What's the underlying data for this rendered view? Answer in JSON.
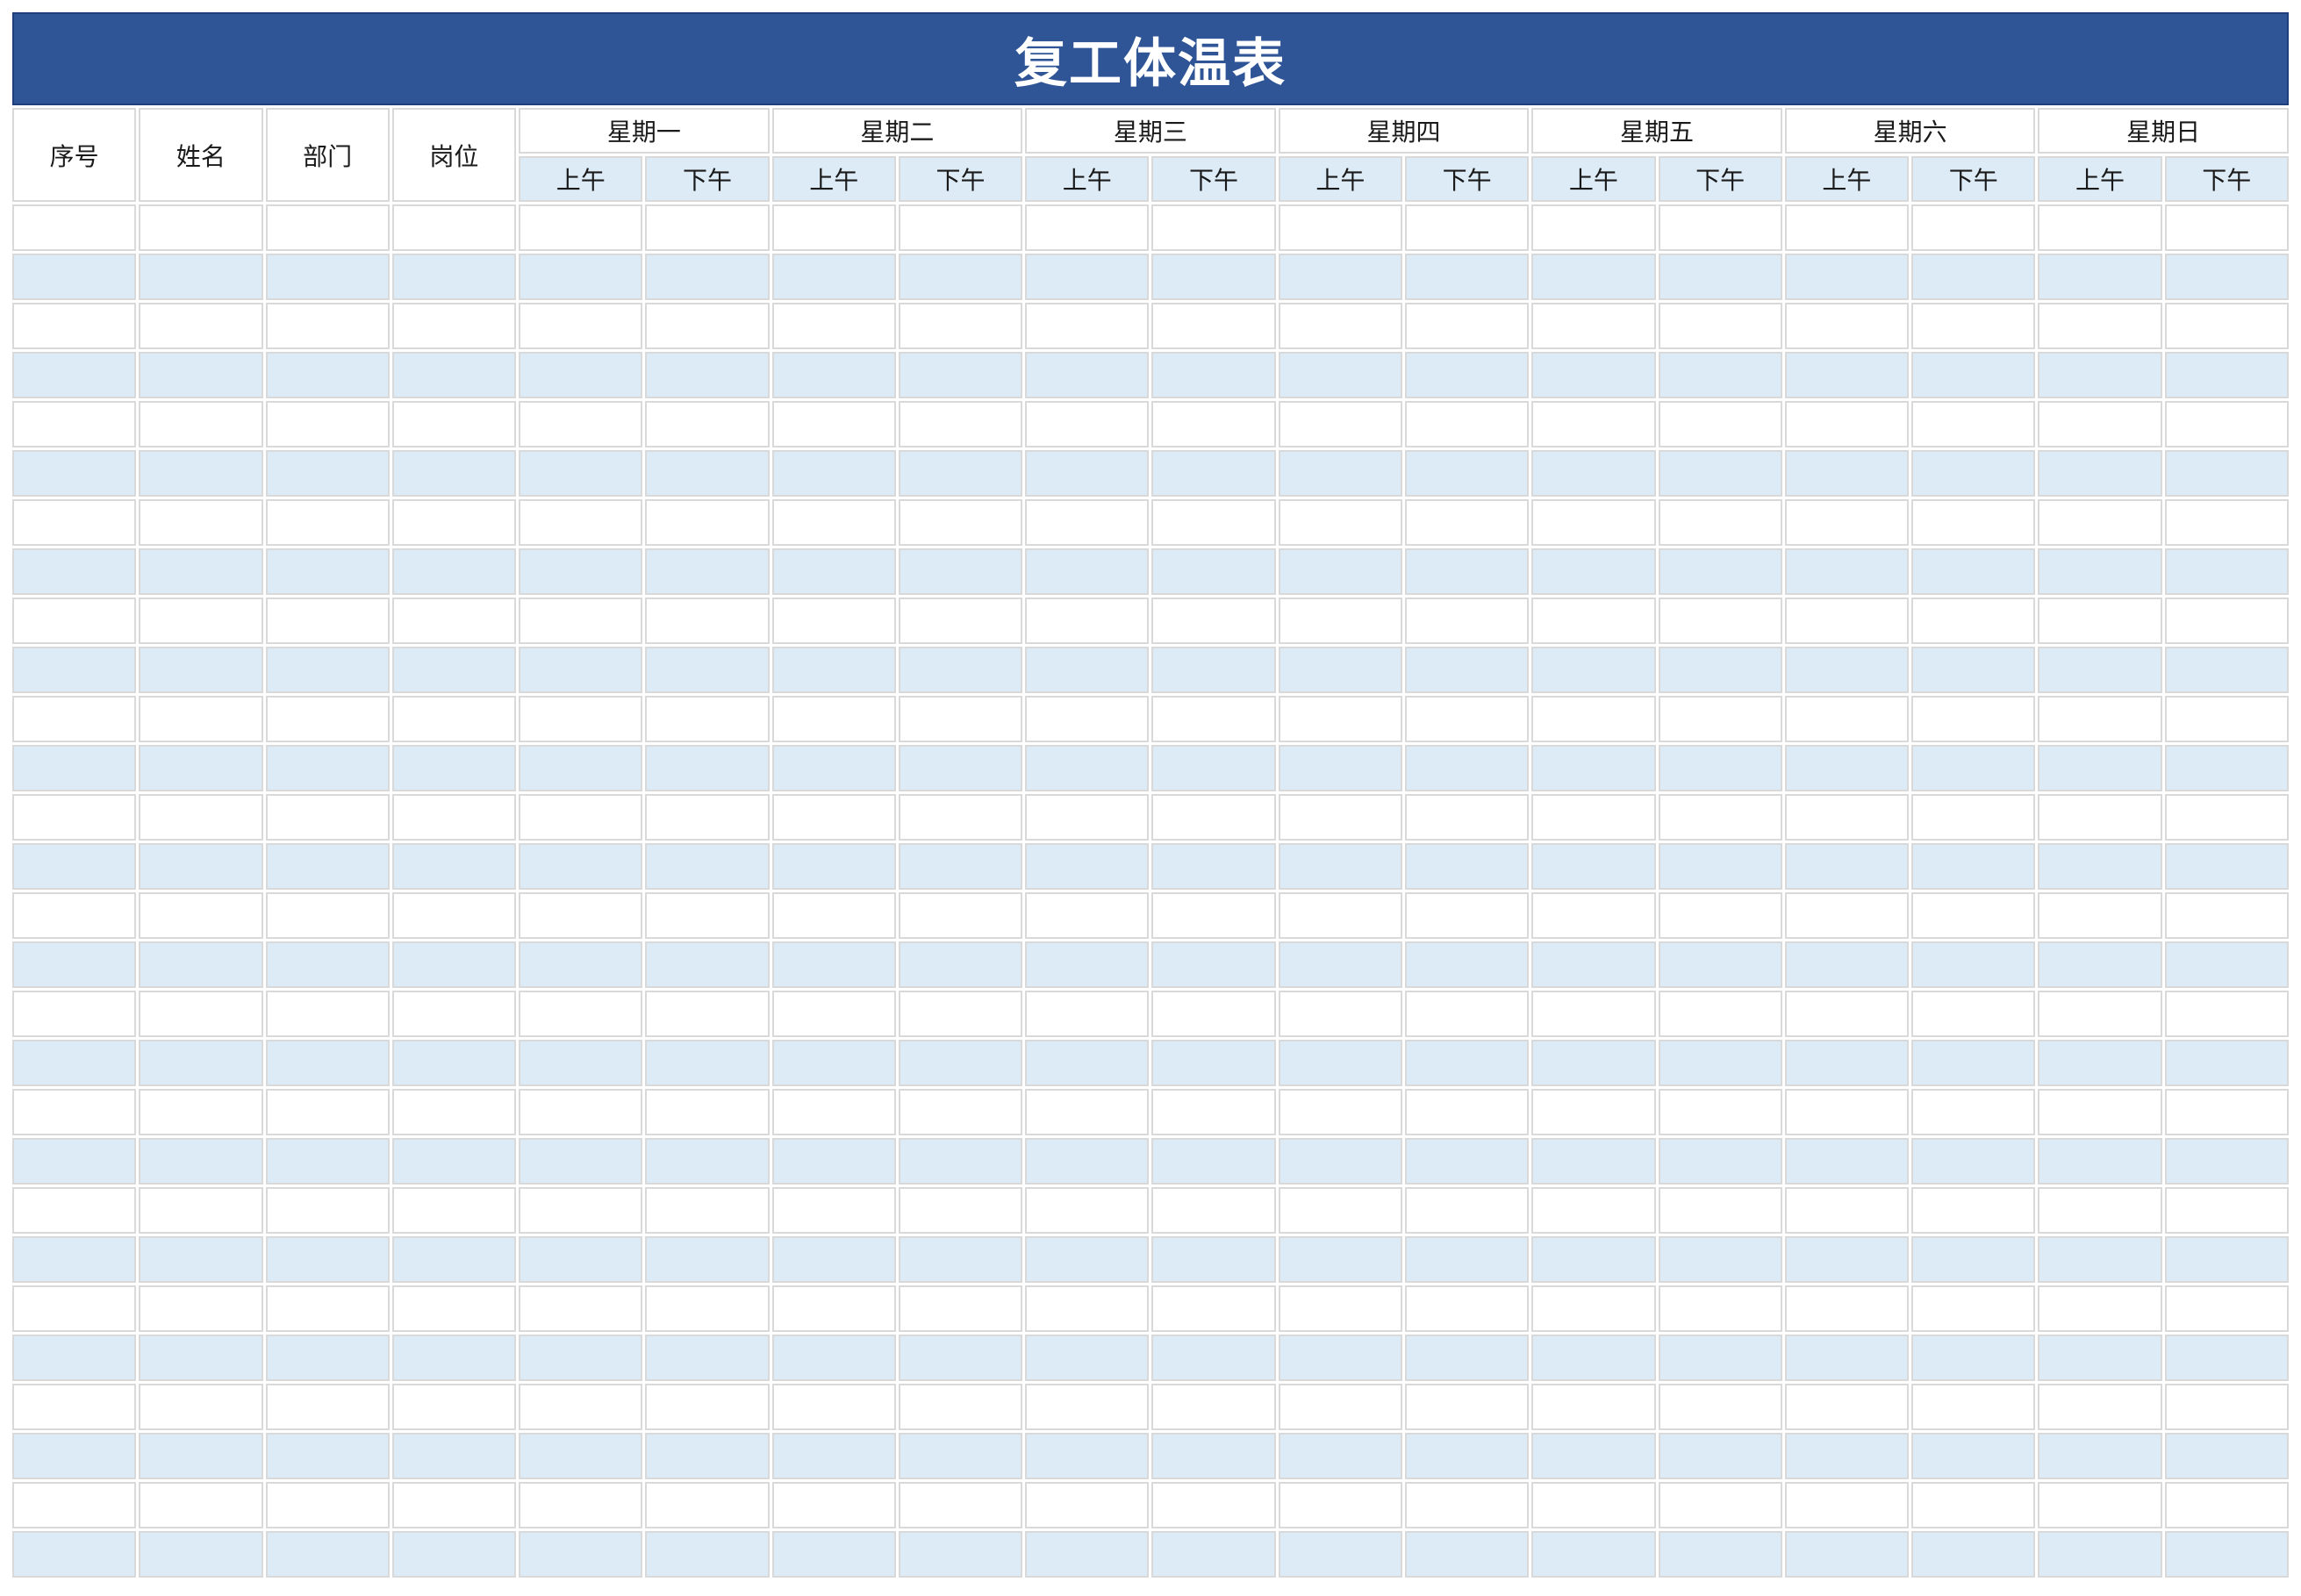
{
  "title": "复工体温表",
  "columns": {
    "index": "序号",
    "name": "姓名",
    "department": "部门",
    "position": "岗位"
  },
  "days": [
    "星期一",
    "星期二",
    "星期三",
    "星期四",
    "星期五",
    "星期六",
    "星期日"
  ],
  "periods": {
    "am": "上午",
    "pm": "下午"
  },
  "data_rows": 28,
  "colors": {
    "title_bg": "#2f5597",
    "title_text": "#ffffff",
    "row_alt": "#ddebf7",
    "cell_border": "#d9d9d9"
  }
}
